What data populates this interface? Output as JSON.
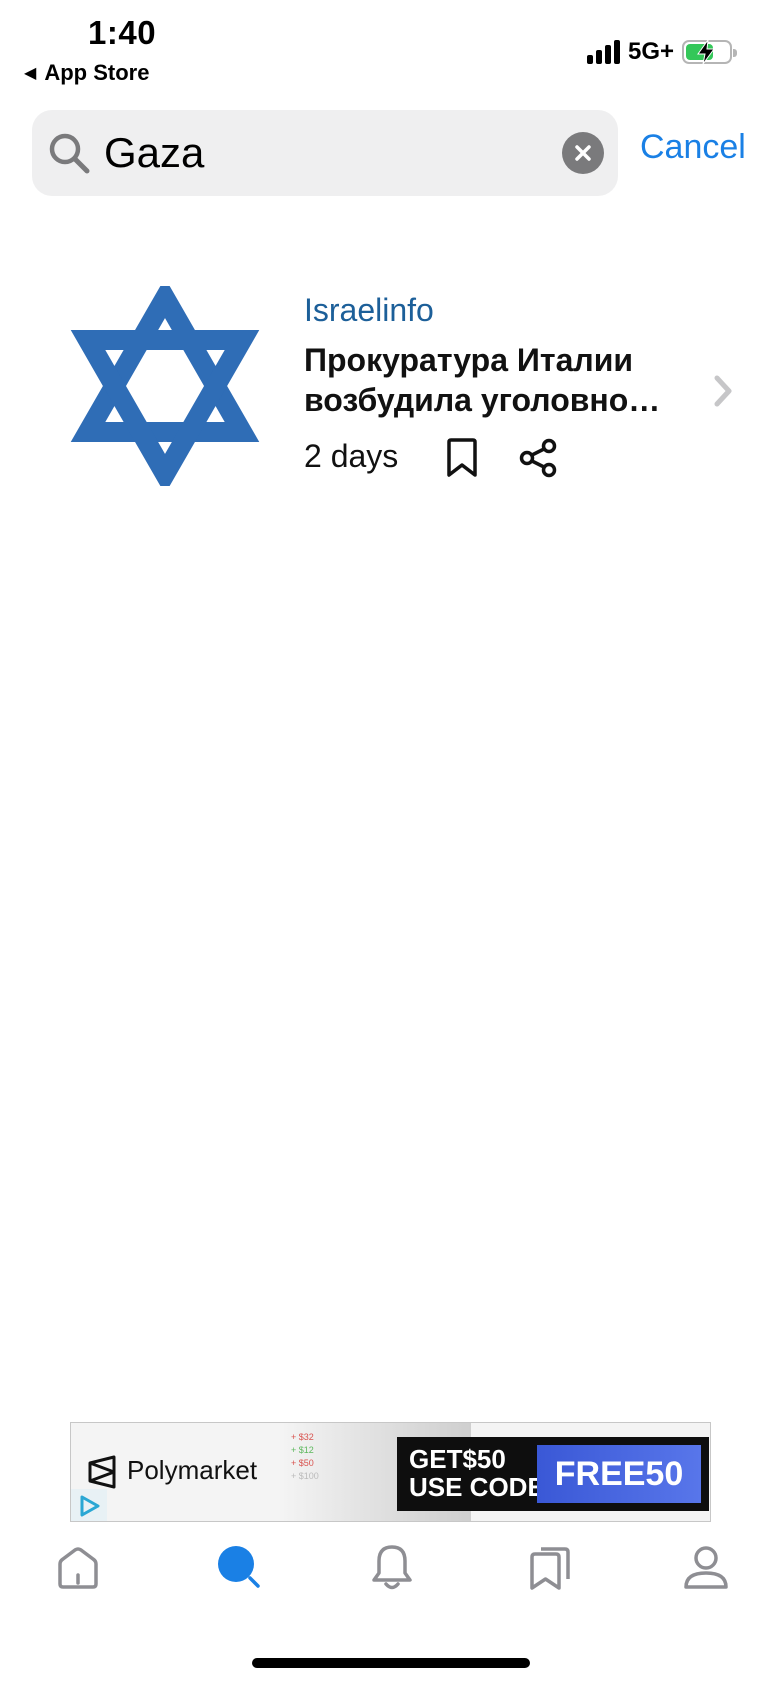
{
  "status_bar": {
    "time": "1:40",
    "back_label": "App Store",
    "network": "5G+",
    "battery_level": 0.65,
    "battery_charging": true
  },
  "search": {
    "query": "Gaza",
    "cancel_label": "Cancel"
  },
  "results": [
    {
      "source": "Israelinfo",
      "title_line1": "Прокуратура Италии",
      "title_line2": "возбудила уголовно…",
      "age": "2 days",
      "thumbnail_icon": "star-of-david-icon"
    }
  ],
  "ad": {
    "brand": "Polymarket",
    "deltas": [
      "+ $32",
      "+ $12",
      "+ $50",
      "+ $100"
    ],
    "promo_line1": "GET$50",
    "promo_line2": "USE CODE",
    "code": "FREE50"
  },
  "tabbar": {
    "items": [
      "home-icon",
      "search-icon",
      "bell-icon",
      "bookmarks-icon",
      "profile-icon"
    ],
    "active": "search-icon"
  },
  "colors": {
    "accent": "#1a80e5",
    "source": "#1c5f99",
    "star": "#2f6db6",
    "tab_inactive": "#8e8e93",
    "search_bg": "#efeff0"
  }
}
